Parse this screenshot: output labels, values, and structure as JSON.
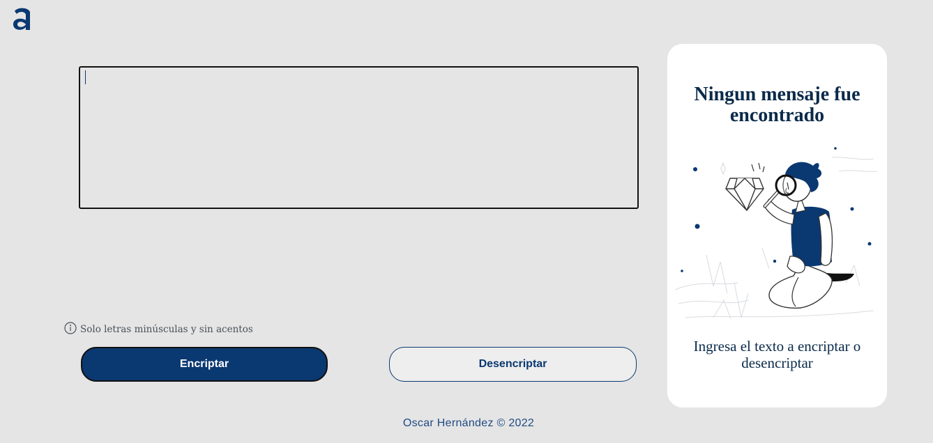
{
  "header": {
    "logo_icon": "alura-a-logo"
  },
  "input": {
    "value": "",
    "placeholder": ""
  },
  "hint": {
    "icon": "info-circle-icon",
    "text": "Solo letras minúsculas y sin acentos"
  },
  "actions": {
    "encrypt_label": "Encriptar",
    "decrypt_label": "Desencriptar"
  },
  "output_panel": {
    "title": "Ningun mensaje fue encontrado",
    "illustration": "person-with-magnifying-glass-and-diamond",
    "subtitle": "Ingresa el texto a encriptar o desencriptar"
  },
  "footer": {
    "text": "Oscar Hernández © 2022"
  },
  "colors": {
    "background": "#e5e5e5",
    "primary": "#0a3871",
    "panel": "#ffffff",
    "text_dark": "#0a2a4a"
  }
}
